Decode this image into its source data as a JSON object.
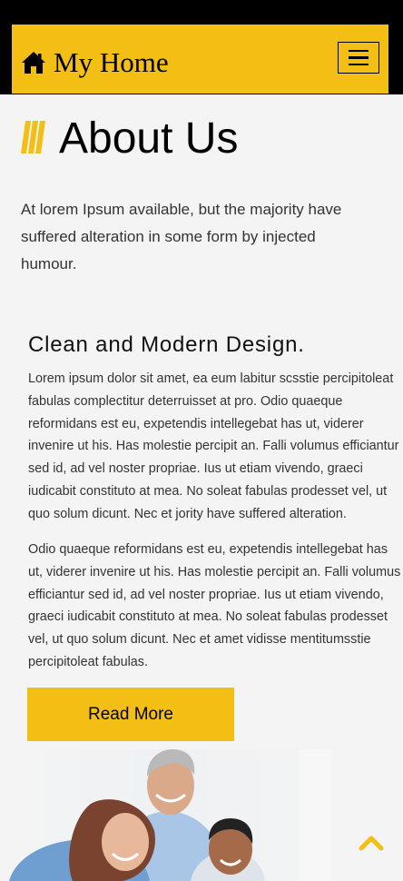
{
  "header": {
    "brand": "My Home",
    "brand_icon": "home-icon",
    "menu_icon": "hamburger-menu-icon",
    "accent_color": "#f4bf14"
  },
  "about": {
    "title": "About Us",
    "intro": "At lorem Ipsum available, but the majority have suffered alteration in some form by injected humour."
  },
  "section": {
    "title": "Clean and Modern Design.",
    "paragraph1": "Lorem ipsum dolor sit amet, ea eum labitur scsstie percipitoleat fabulas complectitur deterruisset at pro. Odio quaeque reformidans est eu, expetendis intellegebat has ut, viderer invenire ut his. Has molestie percipit an. Falli volumus efficiantur sed id, ad vel noster propriae. Ius ut etiam vivendo, graeci iudicabit constituto at mea. No soleat fabulas prodesset vel, ut quo solum dicunt. Nec et jority have suffered alteration.",
    "paragraph2": "Odio quaeque reformidans est eu, expetendis intellegebat has ut, viderer invenire ut his. Has molestie percipit an. Falli volumus efficiantur sed id, ad vel noster propriae. Ius ut etiam vivendo, graeci iudicabit constituto at mea. No soleat fabulas prodesset vel, ut quo solum dicunt. Nec et amet vidisse mentitumsstie percipitoleat fabulas.",
    "read_more": "Read More"
  },
  "scroll_top_icon": "chevron-up-icon"
}
